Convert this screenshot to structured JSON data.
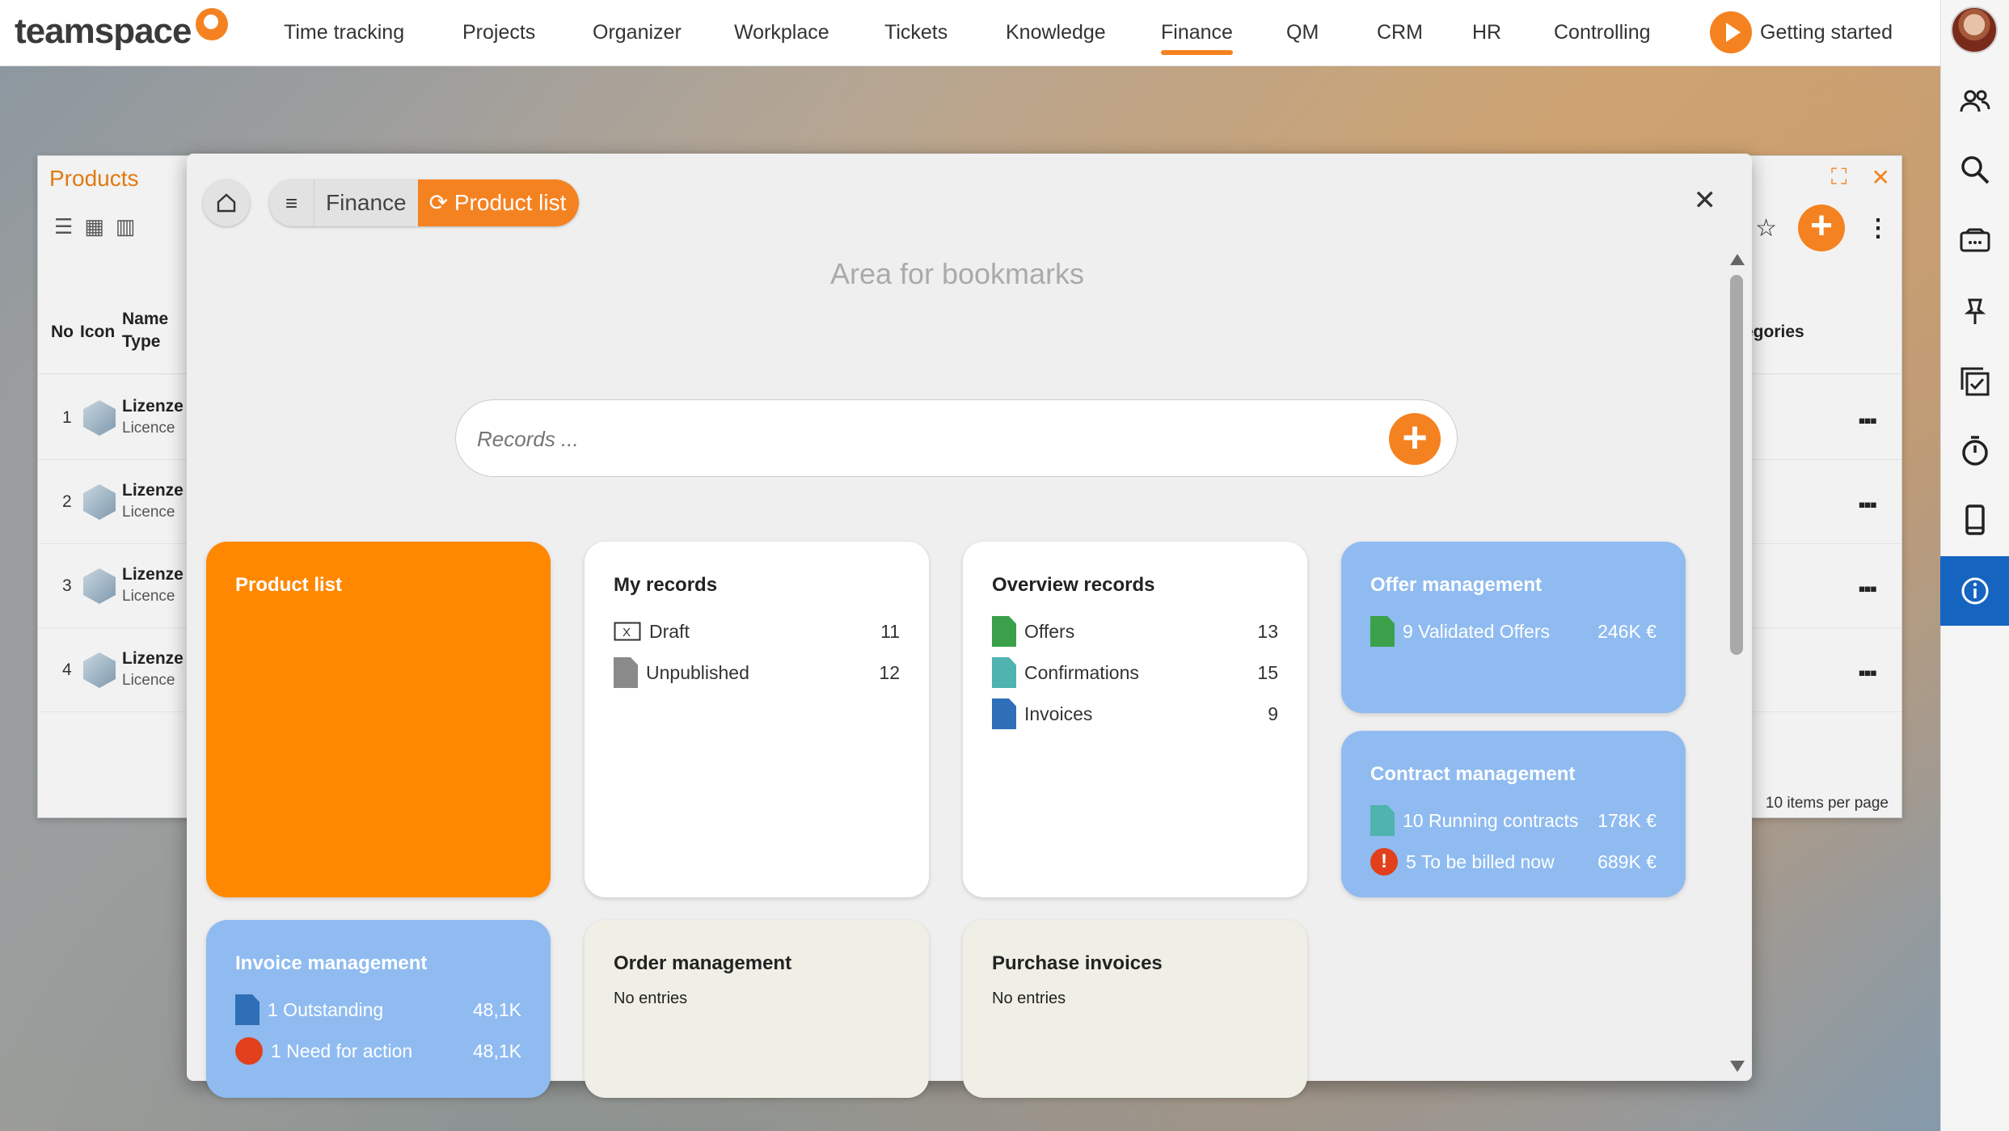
{
  "app": {
    "logo_text": "teamspace"
  },
  "nav": {
    "items": [
      {
        "label": "Time tracking"
      },
      {
        "label": "Projects"
      },
      {
        "label": "Organizer"
      },
      {
        "label": "Workplace"
      },
      {
        "label": "Tickets"
      },
      {
        "label": "Knowledge"
      },
      {
        "label": "Finance",
        "active": true
      },
      {
        "label": "QM"
      },
      {
        "label": "CRM"
      },
      {
        "label": "HR"
      },
      {
        "label": "Controlling"
      }
    ],
    "getting_started": "Getting started"
  },
  "rail": {
    "icons": [
      "avatar",
      "people-icon",
      "search-icon",
      "inbox-icon",
      "pin-icon",
      "tasks-icon",
      "stopwatch-icon",
      "phone-icon",
      "info-icon"
    ],
    "active": "info-icon",
    "accent": "#1565c0"
  },
  "products": {
    "title": "Products",
    "columns": {
      "no": "No",
      "icon": "Icon",
      "name": "Name",
      "type": "Type",
      "categories": "egories"
    },
    "rows": [
      {
        "no": "1",
        "name": "Lizenze",
        "type": "Licence"
      },
      {
        "no": "2",
        "name": "Lizenze",
        "type": "Licence"
      },
      {
        "no": "3",
        "name": "Lizenze",
        "type": "Licence"
      },
      {
        "no": "4",
        "name": "Lizenze",
        "type": "Licence"
      }
    ],
    "pager": {
      "count": "10",
      "label": "items per page"
    }
  },
  "modal": {
    "breadcrumb": {
      "finance": "Finance",
      "current": "Product list"
    },
    "bookmarks_placeholder": "Area for bookmarks",
    "search_placeholder": "Records ...",
    "tiles": {
      "product_list": {
        "title": "Product list"
      },
      "my_records": {
        "title": "My records",
        "rows": [
          {
            "label": "Draft",
            "value": "11"
          },
          {
            "label": "Unpublished",
            "value": "12"
          }
        ]
      },
      "overview_records": {
        "title": "Overview records",
        "rows": [
          {
            "label": "Offers",
            "value": "13"
          },
          {
            "label": "Confirmations",
            "value": "15"
          },
          {
            "label": "Invoices",
            "value": "9"
          }
        ]
      },
      "offer_management": {
        "title": "Offer management",
        "rows": [
          {
            "label": "9 Validated Offers",
            "value": "246K €"
          }
        ]
      },
      "contract_management": {
        "title": "Contract management",
        "rows": [
          {
            "label": "10 Running contracts",
            "value": "178K €"
          },
          {
            "label": "5 To be billed now",
            "value": "689K €"
          }
        ]
      },
      "invoice_management": {
        "title": "Invoice management",
        "rows": [
          {
            "label": "1 Outstanding",
            "value": "48,1K"
          },
          {
            "label": "1 Need for action",
            "value": "48,1K"
          }
        ]
      },
      "order_management": {
        "title": "Order management",
        "empty": "No entries"
      },
      "purchase_invoices": {
        "title": "Purchase invoices",
        "empty": "No entries"
      }
    }
  },
  "colors": {
    "accent": "#f58220",
    "tile_blue": "#8fbbf0",
    "tile_beige": "#efefe6",
    "alert_red": "#e2401c"
  }
}
